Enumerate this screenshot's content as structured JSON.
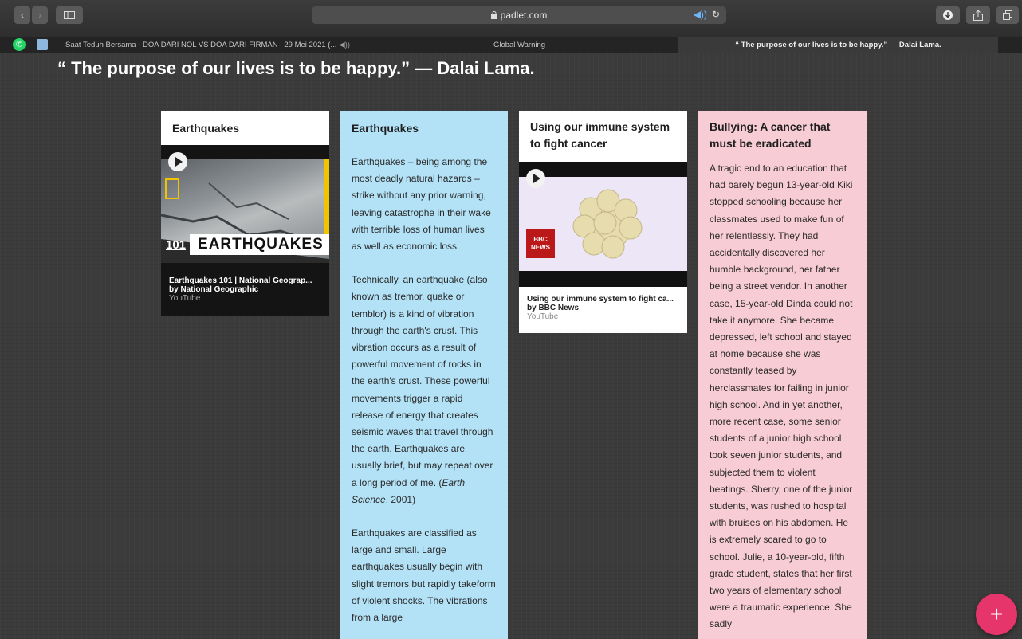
{
  "browser": {
    "url": "padlet.com",
    "lock_icon": "lock-icon"
  },
  "tabs": [
    {
      "label": "Saat Teduh Bersama - DOA DARI NOL VS DOA DARI FIRMAN | 29 Mei 2021 (...",
      "audio": "◀))"
    },
    {
      "label": "Global Warning"
    },
    {
      "label": "“ The purpose of our lives is to be happy.” — Dalai Lama."
    }
  ],
  "page": {
    "title": "“ The purpose of our lives is to be happy.” — Dalai Lama."
  },
  "cards": {
    "quake_video": {
      "title": "Earthquakes",
      "thumb_badge": "101",
      "thumb_text": "EARTHQUAKES",
      "video_title": "Earthquakes 101 | National Geograp...",
      "video_author": "by National Geographic",
      "video_source": "YouTube"
    },
    "quake_text": {
      "title": "Earthquakes",
      "p1": "Earthquakes – being among the most deadly natural hazards – strike without any prior warning, leaving catastrophe in their wake with terrible loss of human lives as well as economic loss.",
      "p2_main": "Technically, an earthquake (also known as tremor, quake or temblor) is a kind of vibration through  the  earth's crust. This vibration occurs as a result of powerful movement of rocks in the earth's crust. These powerful movements trigger a rapid release of energy that creates seismic waves that travel through the earth. Earthquakes are usually brief, but may repeat over a long period of me. (",
      "p2_cite": "Earth Science",
      "p2_end": ". 2001)",
      "p3": "Earthquakes are classified as large and small. Large earthquakes usually begin with slight tremors but rapidly takeform of violent shocks. The vibrations from a large"
    },
    "immune_video": {
      "title": "Using our immune system to fight cancer",
      "bbc_label_top": "BBC",
      "bbc_label_bottom": "NEWS",
      "video_title": "Using our immune system to fight ca...",
      "video_author": "by BBC News",
      "video_source": "YouTube"
    },
    "bullying": {
      "title": "Bullying: A cancer that must be eradicated",
      "text": "A tragic end to an education that had barely begun 13-year-old Kiki stopped schooling because her classmates used to make fun of her relentlessly. They had accidentally discovered her humble background, her father being a street vendor. In another case, 15-year-old Dinda could not take it anymore. She became depressed, left school and stayed at home because she was constantly teased by herclassmates for failing in junior high school. And in yet another, more recent case, some senior students of a junior high school took seven junior students, and subjected them to violent beatings. Sherry, one of the junior students, was rushed to hospital with bruises on his abdomen. He is extremely scared to go to school. Julie, a 10-year-old, fifth grade student, states that her first two years of elementary school were a traumatic experience. She sadly"
    }
  },
  "fab": {
    "label": "+"
  },
  "colors": {
    "card_blue": "#b3e2f7",
    "card_pink": "#f8ccd5",
    "fab": "#e6356a"
  }
}
